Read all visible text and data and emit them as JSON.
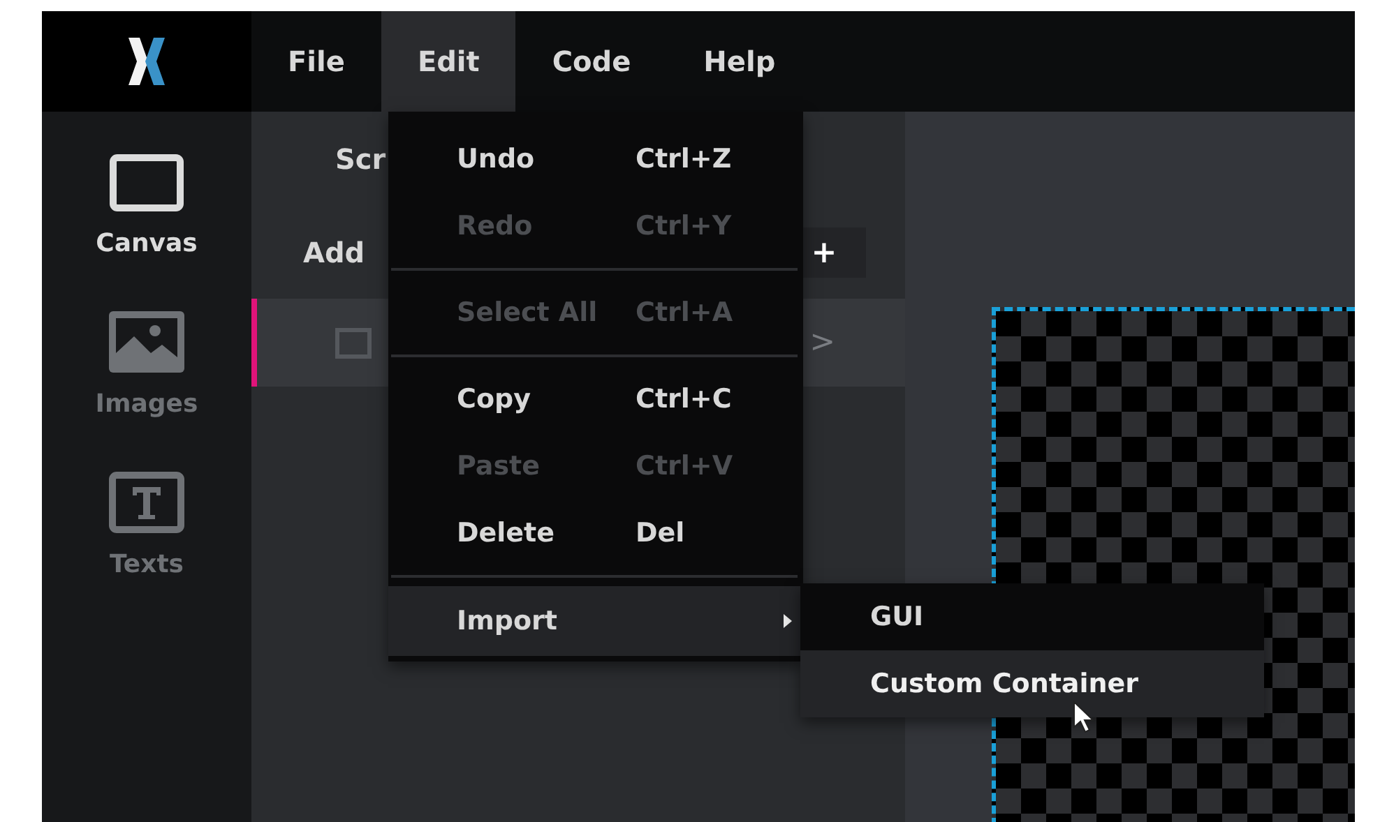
{
  "menubar": [
    {
      "label": "File",
      "selected": false
    },
    {
      "label": "Edit",
      "selected": true
    },
    {
      "label": "Code",
      "selected": false
    },
    {
      "label": "Help",
      "selected": false
    }
  ],
  "sidebar": {
    "items": [
      {
        "label": "Canvas",
        "kind": "canvas",
        "selected": true
      },
      {
        "label": "Images",
        "kind": "images",
        "selected": false
      },
      {
        "label": "Texts",
        "kind": "texts",
        "selected": false
      }
    ]
  },
  "panel": {
    "heading": "Scr",
    "add_label": "Add",
    "add_button": "+",
    "rows": [
      {
        "selected": true,
        "chevron": ">"
      }
    ]
  },
  "edit_menu": {
    "items": [
      {
        "kind": "item",
        "label": "Undo",
        "shortcut": "Ctrl+Z",
        "disabled": false,
        "selected": false
      },
      {
        "kind": "item",
        "label": "Redo",
        "shortcut": "Ctrl+Y",
        "disabled": true,
        "selected": false
      },
      {
        "kind": "separator"
      },
      {
        "kind": "item",
        "label": "Select All",
        "shortcut": "Ctrl+A",
        "disabled": true,
        "selected": false
      },
      {
        "kind": "separator"
      },
      {
        "kind": "item",
        "label": "Copy",
        "shortcut": "Ctrl+C",
        "disabled": false,
        "selected": false
      },
      {
        "kind": "item",
        "label": "Paste",
        "shortcut": "Ctrl+V",
        "disabled": true,
        "selected": false
      },
      {
        "kind": "item",
        "label": "Delete",
        "shortcut": "Del",
        "disabled": false,
        "selected": false
      },
      {
        "kind": "separator"
      },
      {
        "kind": "submenu",
        "label": "Import",
        "disabled": false,
        "selected": true
      }
    ]
  },
  "import_submenu": {
    "items": [
      {
        "label": "GUI",
        "selected": false
      },
      {
        "label": "Custom Container",
        "selected": true
      }
    ]
  }
}
